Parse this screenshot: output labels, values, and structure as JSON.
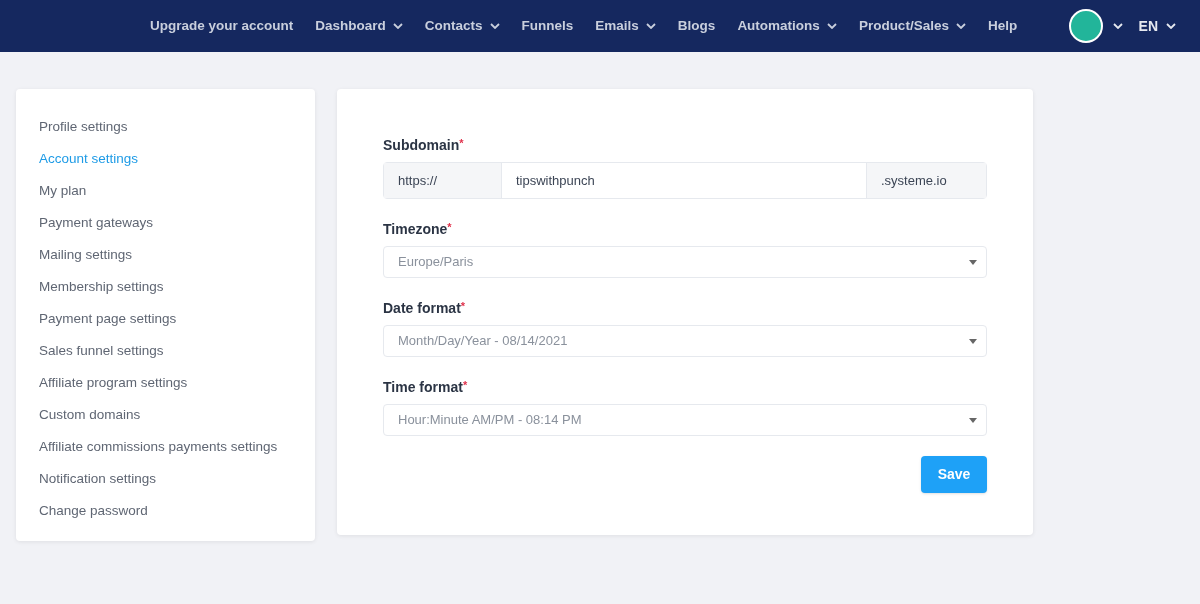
{
  "nav": {
    "items": [
      {
        "label": "Upgrade your account",
        "has_menu": false
      },
      {
        "label": "Dashboard",
        "has_menu": true
      },
      {
        "label": "Contacts",
        "has_menu": true
      },
      {
        "label": "Funnels",
        "has_menu": false
      },
      {
        "label": "Emails",
        "has_menu": true
      },
      {
        "label": "Blogs",
        "has_menu": false
      },
      {
        "label": "Automations",
        "has_menu": true
      },
      {
        "label": "Product/Sales",
        "has_menu": true
      },
      {
        "label": "Help",
        "has_menu": false
      }
    ],
    "language": "EN"
  },
  "sidebar": {
    "items": [
      {
        "label": "Profile settings",
        "selected": false
      },
      {
        "label": "Account settings",
        "selected": true
      },
      {
        "label": "My plan",
        "selected": false
      },
      {
        "label": "Payment gateways",
        "selected": false
      },
      {
        "label": "Mailing settings",
        "selected": false
      },
      {
        "label": "Membership settings",
        "selected": false
      },
      {
        "label": "Payment page settings",
        "selected": false
      },
      {
        "label": "Sales funnel settings",
        "selected": false
      },
      {
        "label": "Affiliate program settings",
        "selected": false
      },
      {
        "label": "Custom domains",
        "selected": false
      },
      {
        "label": "Affiliate commissions payments settings",
        "selected": false
      },
      {
        "label": "Notification settings",
        "selected": false
      },
      {
        "label": "Change password",
        "selected": false
      }
    ]
  },
  "form": {
    "fields": [
      {
        "kind": "subdomain",
        "label": "Subdomain",
        "required_mark": "*",
        "prefix": "https://",
        "value": "tipswithpunch",
        "suffix": ".systeme.io"
      },
      {
        "kind": "select",
        "label": "Timezone",
        "required_mark": "*",
        "value": "Europe/Paris"
      },
      {
        "kind": "select",
        "label": "Date format",
        "required_mark": "*",
        "value": "Month/Day/Year - 08/14/2021"
      },
      {
        "kind": "select",
        "label": "Time format",
        "required_mark": "*",
        "value": "Hour:Minute AM/PM - 08:14 PM"
      }
    ],
    "save": "Save"
  }
}
